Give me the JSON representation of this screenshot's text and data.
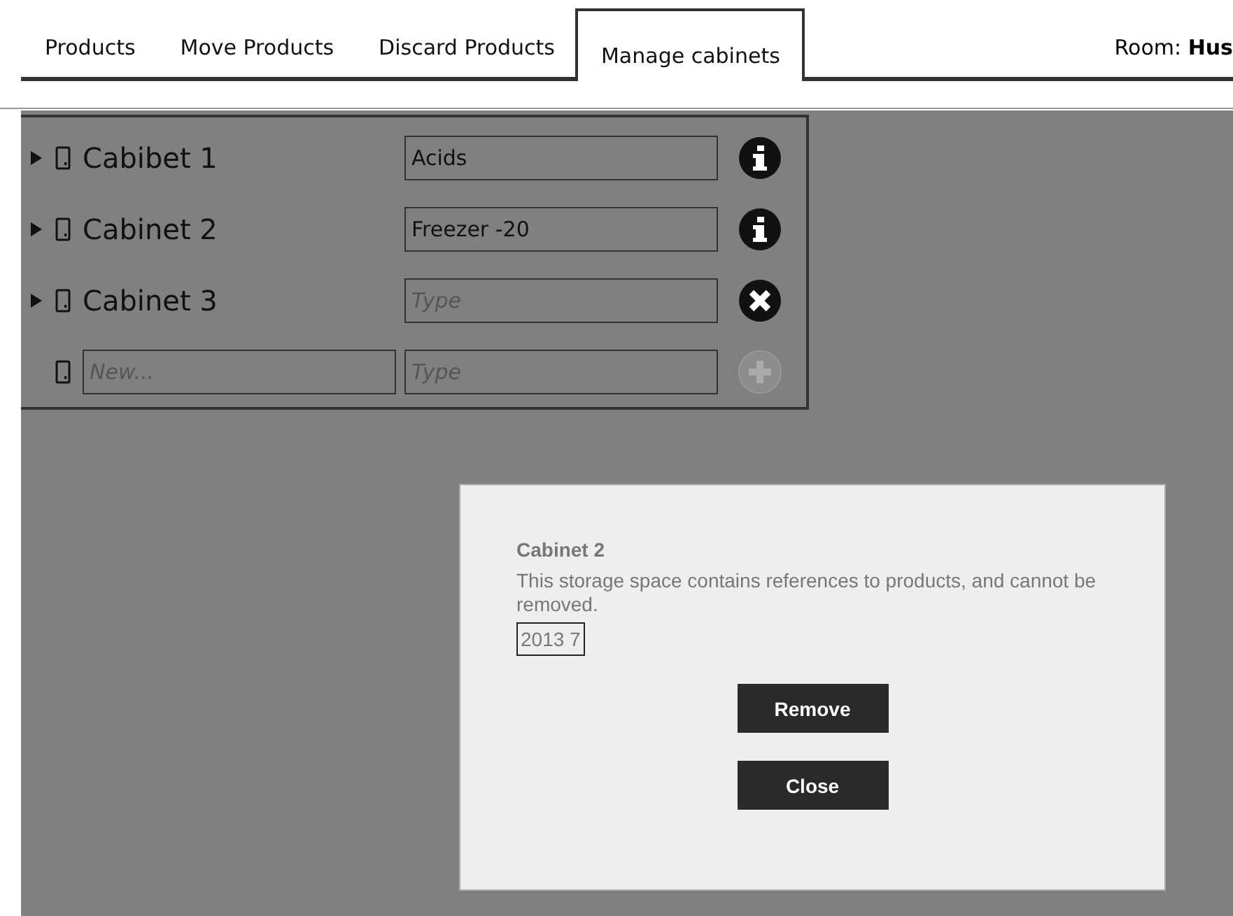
{
  "tabs": [
    {
      "label": "Products",
      "selected": false
    },
    {
      "label": "Move Products",
      "selected": false
    },
    {
      "label": "Discard Products",
      "selected": false
    },
    {
      "label": "Manage cabinets",
      "selected": true
    }
  ],
  "room": {
    "label": "Room:",
    "value": "Hus"
  },
  "cabinets": [
    {
      "kind": "cabinet",
      "name": "Cabibet 1",
      "type": "Acids",
      "button": {
        "kind": "info",
        "disabled": false
      }
    },
    {
      "kind": "cabinet",
      "name": "Cabinet 2",
      "type": "Freezer -20",
      "button": {
        "kind": "info",
        "disabled": false
      }
    },
    {
      "kind": "cabinet",
      "name": "Cabinet 3",
      "type_placeholder": "Type",
      "button": {
        "kind": "remove",
        "disabled": false
      }
    },
    {
      "kind": "new",
      "name_placeholder": "New...",
      "type_placeholder": "Type",
      "button": {
        "kind": "add",
        "disabled": true
      }
    }
  ],
  "dialog": {
    "title": "Cabinet 2",
    "message": "This storage space contains references to products, and cannot be removed.",
    "references": [
      "2013 7"
    ],
    "buttons": [
      "Remove",
      "Close"
    ]
  }
}
